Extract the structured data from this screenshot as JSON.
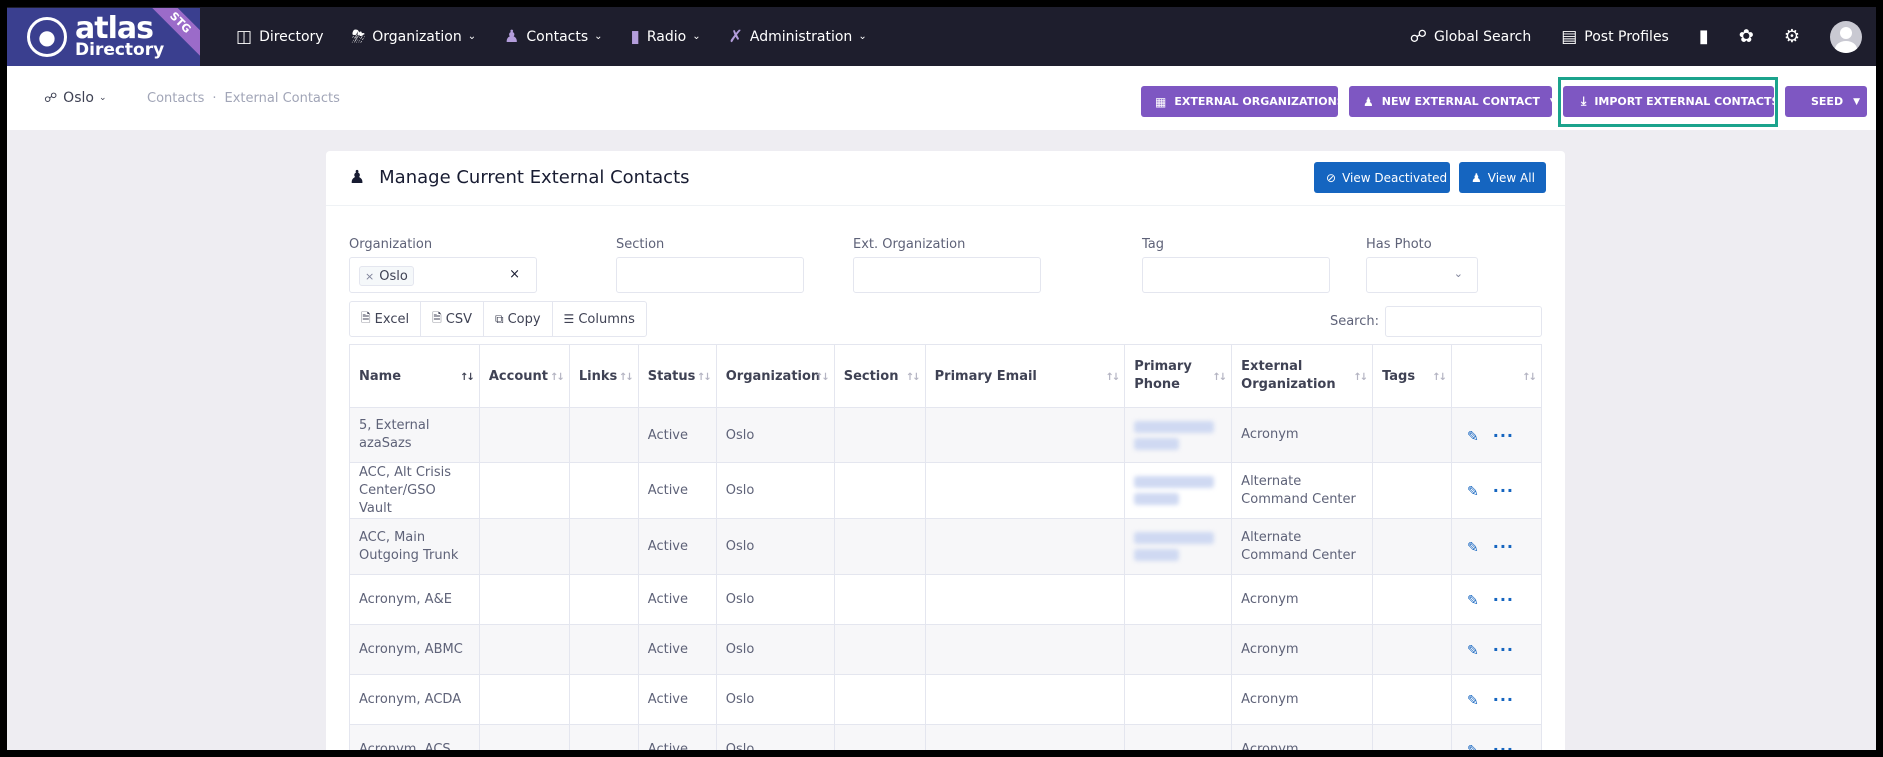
{
  "brand": {
    "name": "atlas",
    "sub": "Directory",
    "ribbon": "STG"
  },
  "nav": {
    "items": [
      {
        "label": "Directory",
        "icon": "directory-icon"
      },
      {
        "label": "Organization",
        "icon": "org-chart-icon"
      },
      {
        "label": "Contacts",
        "icon": "contacts-icon"
      },
      {
        "label": "Radio",
        "icon": "radio-icon"
      },
      {
        "label": "Administration",
        "icon": "tools-icon"
      }
    ],
    "global_search": "Global Search",
    "post_profiles": "Post Profiles"
  },
  "subheader": {
    "site": "Oslo",
    "breadcrumb": [
      "Contacts",
      "External Contacts"
    ],
    "buttons": {
      "external_orgs": "EXTERNAL ORGANIZATIONS",
      "new_contact": "NEW EXTERNAL CONTACT",
      "import": "IMPORT EXTERNAL CONTACTS",
      "seed": "SEED"
    }
  },
  "card": {
    "title": "Manage Current External Contacts",
    "view_deactivated": "View Deactivated",
    "view_all": "View All"
  },
  "filters": {
    "organization": {
      "label": "Organization",
      "value": "Oslo"
    },
    "section": {
      "label": "Section",
      "value": ""
    },
    "ext_org": {
      "label": "Ext. Organization",
      "value": ""
    },
    "tag": {
      "label": "Tag",
      "value": ""
    },
    "has_photo": {
      "label": "Has Photo",
      "value": ""
    }
  },
  "export": {
    "excel": "Excel",
    "csv": "CSV",
    "copy": "Copy",
    "columns": "Columns"
  },
  "search": {
    "label": "Search:",
    "value": ""
  },
  "table": {
    "headers": [
      "Name",
      "Account",
      "Links",
      "Status",
      "Organization",
      "Section",
      "Primary Email",
      "Primary Phone",
      "External Organization",
      "Tags",
      ""
    ],
    "rows": [
      {
        "name": "5, External azaSazs",
        "status": "Active",
        "org": "Oslo",
        "ext_org": "Acronym",
        "phone_redacted": true
      },
      {
        "name": "ACC, Alt Crisis Center/GSO Vault",
        "status": "Active",
        "org": "Oslo",
        "ext_org": "Alternate Command Center",
        "phone_redacted": true
      },
      {
        "name": "ACC, Main Outgoing Trunk",
        "status": "Active",
        "org": "Oslo",
        "ext_org": "Alternate Command Center",
        "phone_redacted": true
      },
      {
        "name": "Acronym, A&E",
        "status": "Active",
        "org": "Oslo",
        "ext_org": "Acronym",
        "phone_redacted": false
      },
      {
        "name": "Acronym, ABMC",
        "status": "Active",
        "org": "Oslo",
        "ext_org": "Acronym",
        "phone_redacted": false
      },
      {
        "name": "Acronym, ACDA",
        "status": "Active",
        "org": "Oslo",
        "ext_org": "Acronym",
        "phone_redacted": false
      },
      {
        "name": "Acronym, ACS",
        "status": "Active",
        "org": "Oslo",
        "ext_org": "Acronym",
        "phone_redacted": false
      }
    ]
  }
}
